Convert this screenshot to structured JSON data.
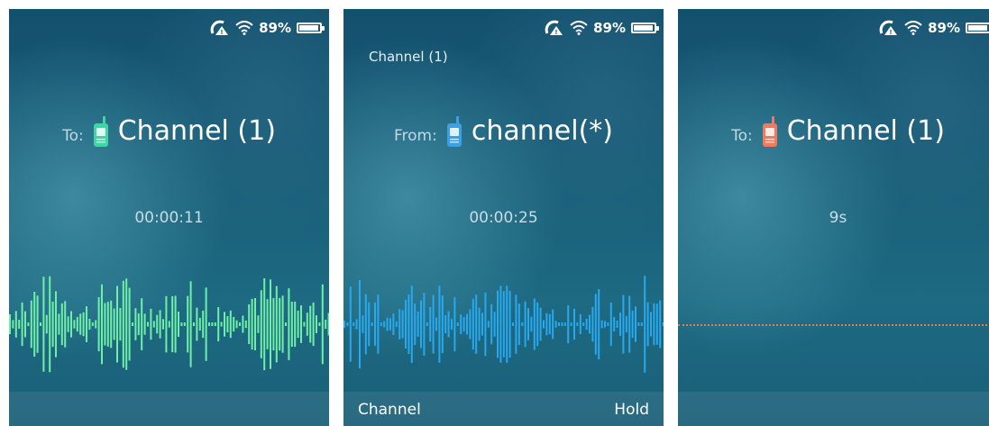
{
  "status_bar": {
    "battery_percent": "89%",
    "battery_level": 0.89,
    "icons": [
      "alert-signal-icon",
      "wifi-icon",
      "battery-icon"
    ]
  },
  "screens": [
    {
      "top_label": "",
      "prefix": "To:",
      "channel_name": "Channel (1)",
      "timer": "00:00:11",
      "radio_icon_color": "#3fd6a6",
      "wave_color": "#6ff0a6",
      "mode": "transmitting",
      "softkeys": {
        "left": "",
        "right": ""
      }
    },
    {
      "top_label": "Channel (1)",
      "prefix": "From:",
      "channel_name": "channel(*)",
      "timer": "00:00:25",
      "radio_icon_color": "#3aa0e8",
      "wave_color": "#29a8ee",
      "mode": "receiving",
      "softkeys": {
        "left": "Channel",
        "right": "Hold"
      }
    },
    {
      "top_label": "",
      "prefix": "To:",
      "channel_name": "Channel (1)",
      "timer": "9s",
      "radio_icon_color": "#ef7b5c",
      "wave_color": "#e87a5e",
      "mode": "waiting",
      "softkeys": {
        "left": "",
        "right": ""
      }
    }
  ]
}
